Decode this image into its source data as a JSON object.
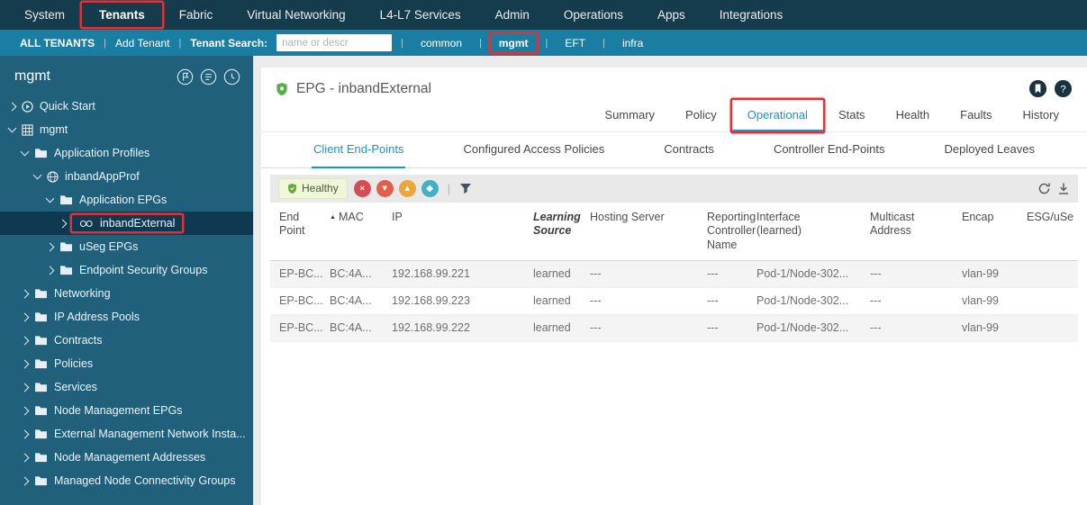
{
  "colors": {
    "accent": "#1797c8",
    "annotation": "#e03236",
    "healthy_green": "#67a83c"
  },
  "top_nav": {
    "items": [
      {
        "label": "System"
      },
      {
        "label": "Tenants",
        "active": true,
        "callout": true
      },
      {
        "label": "Fabric"
      },
      {
        "label": "Virtual Networking"
      },
      {
        "label": "L4-L7 Services"
      },
      {
        "label": "Admin"
      },
      {
        "label": "Operations"
      },
      {
        "label": "Apps"
      },
      {
        "label": "Integrations"
      }
    ]
  },
  "tenant_bar": {
    "all_tenants_label": "ALL TENANTS",
    "add_tenant_label": "Add Tenant",
    "search_label": "Tenant Search:",
    "search_placeholder": "name or descr",
    "tenants": [
      {
        "label": "common"
      },
      {
        "label": "mgmt",
        "active": true,
        "callout": true
      },
      {
        "label": "EFT"
      },
      {
        "label": "infra"
      }
    ]
  },
  "sidebar": {
    "title": "mgmt",
    "header_icons": [
      "pin-icon",
      "notes-icon",
      "history-icon"
    ],
    "tree": [
      {
        "label": "Quick Start",
        "level": 0,
        "arrow": "collapsed",
        "icon": "quickstart"
      },
      {
        "label": "mgmt",
        "level": 0,
        "arrow": "expanded",
        "icon": "tenant"
      },
      {
        "label": "Application Profiles",
        "level": 1,
        "arrow": "expanded",
        "icon": "folder"
      },
      {
        "label": "inbandAppProf",
        "level": 2,
        "arrow": "expanded",
        "icon": "appprofile"
      },
      {
        "label": "Application EPGs",
        "level": 3,
        "arrow": "expanded",
        "icon": "folder"
      },
      {
        "label": "inbandExternal",
        "level": 4,
        "arrow": "collapsed",
        "icon": "epg",
        "selected": true,
        "callout": true
      },
      {
        "label": "uSeg EPGs",
        "level": 3,
        "arrow": "collapsed",
        "icon": "folder"
      },
      {
        "label": "Endpoint Security Groups",
        "level": 3,
        "arrow": "collapsed",
        "icon": "folder"
      },
      {
        "label": "Networking",
        "level": 1,
        "arrow": "collapsed",
        "icon": "folder"
      },
      {
        "label": "IP Address Pools",
        "level": 1,
        "arrow": "collapsed",
        "icon": "folder"
      },
      {
        "label": "Contracts",
        "level": 1,
        "arrow": "collapsed",
        "icon": "folder"
      },
      {
        "label": "Policies",
        "level": 1,
        "arrow": "collapsed",
        "icon": "folder"
      },
      {
        "label": "Services",
        "level": 1,
        "arrow": "collapsed",
        "icon": "folder"
      },
      {
        "label": "Node Management EPGs",
        "level": 1,
        "arrow": "collapsed",
        "icon": "folder"
      },
      {
        "label": "External Management Network Insta...",
        "level": 1,
        "arrow": "collapsed",
        "icon": "folder"
      },
      {
        "label": "Node Management Addresses",
        "level": 1,
        "arrow": "collapsed",
        "icon": "folder"
      },
      {
        "label": "Managed Node Connectivity Groups",
        "level": 1,
        "arrow": "collapsed",
        "icon": "folder"
      }
    ]
  },
  "main": {
    "page_title": "EPG - inbandExternal",
    "title_icon": "epg-shield-icon",
    "header_icons": [
      "bookmark-icon",
      "help-icon"
    ],
    "tabs": [
      {
        "label": "Summary"
      },
      {
        "label": "Policy"
      },
      {
        "label": "Operational",
        "active": true,
        "callout": true
      },
      {
        "label": "Stats"
      },
      {
        "label": "Health"
      },
      {
        "label": "Faults"
      },
      {
        "label": "History"
      }
    ],
    "subtabs": [
      {
        "label": "Client End-Points",
        "active": true
      },
      {
        "label": "Configured Access Policies"
      },
      {
        "label": "Contracts"
      },
      {
        "label": "Controller End-Points"
      },
      {
        "label": "Deployed Leaves"
      }
    ],
    "toolbar": {
      "health_badge": {
        "label": "Healthy",
        "icon": "shield-icon"
      },
      "severity_icons": [
        {
          "name": "critical-icon",
          "glyph": "×",
          "color": "#d64c52"
        },
        {
          "name": "major-icon",
          "glyph": "▼",
          "color": "#df6049"
        },
        {
          "name": "minor-icon",
          "glyph": "▲",
          "color": "#eba63f"
        },
        {
          "name": "warning-icon",
          "glyph": "◆",
          "color": "#43b1c5"
        }
      ],
      "filter_icon": "filter-icon",
      "right_icons": [
        "refresh-icon",
        "download-icon"
      ]
    },
    "table": {
      "columns": [
        {
          "label": "End Point"
        },
        {
          "label": "MAC",
          "sorted": "asc"
        },
        {
          "label": "IP"
        },
        {
          "label": "Learning Source",
          "emphasis": true
        },
        {
          "label": "Hosting Server"
        },
        {
          "label": "Reporting Controller Name"
        },
        {
          "label": "Interface (learned)"
        },
        {
          "label": "Multicast Address"
        },
        {
          "label": "Encap"
        },
        {
          "label": "ESG/uSe"
        }
      ],
      "rows": [
        [
          "EP-BC...",
          "BC:4A...",
          "192.168.99.221",
          "learned",
          "---",
          "---",
          "Pod-1/Node-302...",
          "---",
          "vlan-99",
          ""
        ],
        [
          "EP-BC...",
          "BC:4A...",
          "192.168.99.223",
          "learned",
          "---",
          "---",
          "Pod-1/Node-302...",
          "---",
          "vlan-99",
          ""
        ],
        [
          "EP-BC...",
          "BC:4A...",
          "192.168.99.222",
          "learned",
          "---",
          "---",
          "Pod-1/Node-302...",
          "---",
          "vlan-99",
          ""
        ]
      ]
    }
  }
}
